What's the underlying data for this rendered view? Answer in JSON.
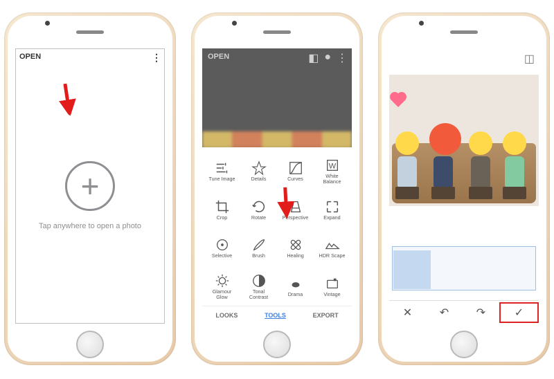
{
  "screen1": {
    "open_label": "OPEN",
    "hint": "Tap anywhere to open a photo",
    "plus_glyph": "+"
  },
  "screen2": {
    "open_label": "OPEN",
    "tabs": {
      "looks": "LOOKS",
      "tools": "TOOLS",
      "export": "EXPORT"
    },
    "tools": [
      {
        "id": "tune-image",
        "label": "Tune Image"
      },
      {
        "id": "details",
        "label": "Details"
      },
      {
        "id": "curves",
        "label": "Curves"
      },
      {
        "id": "white-balance",
        "label": "White\nBalance"
      },
      {
        "id": "crop",
        "label": "Crop"
      },
      {
        "id": "rotate",
        "label": "Rotate"
      },
      {
        "id": "perspective",
        "label": "Perspective"
      },
      {
        "id": "expand",
        "label": "Expand"
      },
      {
        "id": "selective",
        "label": "Selective"
      },
      {
        "id": "brush",
        "label": "Brush"
      },
      {
        "id": "healing",
        "label": "Healing"
      },
      {
        "id": "hdr-scape",
        "label": "HDR Scape"
      },
      {
        "id": "glamour-glow",
        "label": "Glamour\nGlow"
      },
      {
        "id": "tonal-contrast",
        "label": "Tonal\nContrast"
      },
      {
        "id": "drama",
        "label": "Drama"
      },
      {
        "id": "vintage",
        "label": "Vintage"
      }
    ]
  },
  "screen3": {
    "actions": {
      "close": "✕",
      "undo": "↶",
      "redo": "↷",
      "apply": "✓"
    }
  },
  "annotations": {
    "arrow_color": "#e21b1b"
  }
}
